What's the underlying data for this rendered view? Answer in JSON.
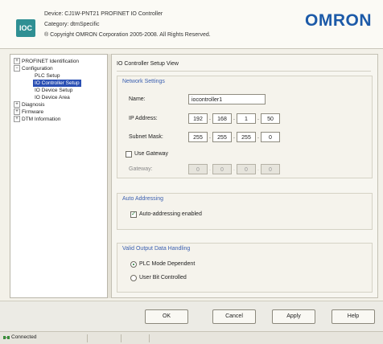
{
  "header": {
    "app_icon": "IOC",
    "device_line": "Device: CJ1W-PNT21 PROFINET IO Controller",
    "category_line": "Category: dtmSpecific",
    "copyright_line": "® Copyright OMRON Corporation 2005-2008. All Rights Reserved.",
    "logo": "OMRON"
  },
  "tree": {
    "items": [
      {
        "label": "PROFINET Identification",
        "expander": "+"
      },
      {
        "label": "Configuration",
        "expander": "−"
      },
      {
        "label": "PLC Setup"
      },
      {
        "label": "IO Controller Setup",
        "selected": true
      },
      {
        "label": "IO Device Setup"
      },
      {
        "label": "IO Device Area"
      },
      {
        "label": "Diagnosis",
        "expander": "+"
      },
      {
        "label": "Firmware",
        "expander": "+"
      },
      {
        "label": "DTM Information",
        "expander": "+"
      }
    ]
  },
  "panel": {
    "title": "IO Controller Setup View",
    "network": {
      "title": "Network Settings",
      "name_label": "Name:",
      "name_value": "iocontroller1",
      "ip_label": "IP Address:",
      "ip": [
        "192",
        "168",
        "1",
        "50"
      ],
      "subnet_label": "Subnet Mask:",
      "subnet": [
        "255",
        "255",
        "255",
        "0"
      ],
      "use_gateway_label": "Use Gateway",
      "use_gateway_checked": false,
      "gateway_label": "Gateway:",
      "gateway": [
        "0",
        "0",
        "0",
        "0"
      ]
    },
    "auto": {
      "title": "Auto Addressing",
      "checkbox_label": "Auto-addressing enabled",
      "checked": true
    },
    "valid": {
      "title": "Valid Output Data Handling",
      "option1": "PLC Mode Dependent",
      "option2": "User Bit Controlled",
      "selected": 1
    }
  },
  "buttons": {
    "ok": "OK",
    "cancel": "Cancel",
    "apply": "Apply",
    "help": "Help"
  },
  "status": {
    "text": "Connected"
  }
}
